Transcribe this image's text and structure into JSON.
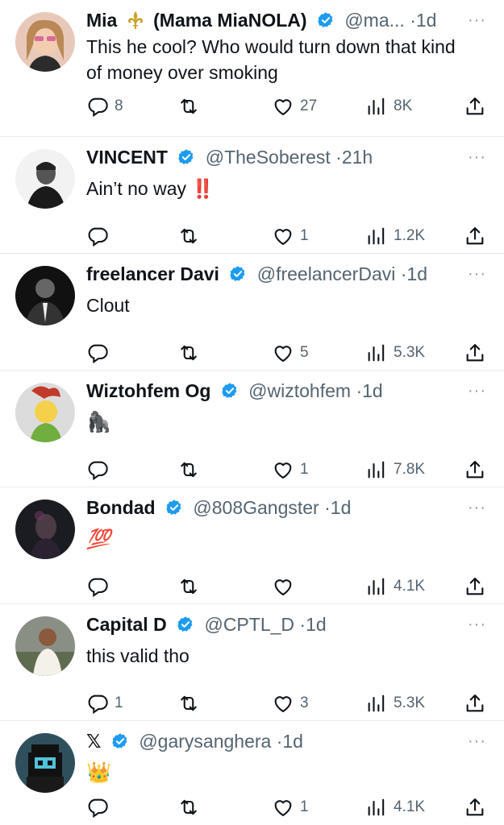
{
  "colors": {
    "accent": "#1d9bf0",
    "muted": "#536471",
    "text": "#0f1419",
    "divider": "#e6e9ec"
  },
  "tweets": [
    {
      "name": "Mia",
      "name_suffix": "(Mama MiaNOLA)",
      "has_fleur": true,
      "handle": "@ma...",
      "dot": "·",
      "time": "1d",
      "text": "This he cool? Who would turn down that kind of money over smoking",
      "replies": "8",
      "retweets": "",
      "likes": "27",
      "views": "8K"
    },
    {
      "name": "VINCENT",
      "handle": "@TheSoberest",
      "dot": "·",
      "time": "21h",
      "text": "Ain’t no way",
      "emoji": "‼️",
      "replies": "",
      "retweets": "",
      "likes": "1",
      "views": "1.2K"
    },
    {
      "name": "freelancer Davi",
      "handle": "@freelancerDavi",
      "dot": "·",
      "time": "1d",
      "text": "Clout",
      "replies": "",
      "retweets": "",
      "likes": "5",
      "views": "5.3K"
    },
    {
      "name": "Wiztohfem Og",
      "handle": "@wiztohfem",
      "dot": "·",
      "time": "1d",
      "text": "",
      "emoji": "🦍",
      "replies": "",
      "retweets": "",
      "likes": "1",
      "views": "7.8K"
    },
    {
      "name": "Bondad",
      "handle": "@808Gangster",
      "dot": "·",
      "time": "1d",
      "text": "",
      "emoji": "💯",
      "replies": "",
      "retweets": "",
      "likes": "",
      "views": "4.1K"
    },
    {
      "name": "Capital D",
      "handle": "@CPTL_D",
      "dot": "·",
      "time": "1d",
      "text": "this valid tho",
      "replies": "1",
      "retweets": "",
      "likes": "3",
      "views": "5.3K"
    },
    {
      "name": "𝕏",
      "handle": "@garysanghera",
      "dot": "·",
      "time": "1d",
      "text": "",
      "emoji": "👑",
      "replies": "",
      "retweets": "",
      "likes": "1",
      "views": "4.1K"
    }
  ],
  "icons": {
    "more": "more-dots-icon",
    "verified": "verified-badge-icon",
    "reply": "reply-icon",
    "retweet": "retweet-icon",
    "like": "heart-icon",
    "views": "views-bar-chart-icon",
    "share": "share-icon"
  },
  "more_glyph": "···"
}
